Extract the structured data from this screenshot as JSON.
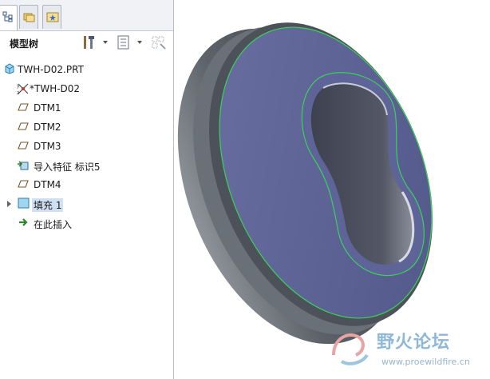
{
  "model_tree": {
    "title": "模型树",
    "tabs": [
      {
        "icon": "model-tree-icon",
        "active": true
      },
      {
        "icon": "folder-browser-icon",
        "active": false
      },
      {
        "icon": "favorites-icon",
        "active": false
      }
    ],
    "toolbar_icons": [
      "settings-icon",
      "show-icon",
      "filter-icon"
    ],
    "items": [
      {
        "label": "TWH-D02.PRT",
        "icon": "part-icon"
      },
      {
        "label": "TWH-D02",
        "icon": "coordinate-system-icon"
      },
      {
        "label": "DTM1",
        "icon": "datum-plane-icon"
      },
      {
        "label": "DTM2",
        "icon": "datum-plane-icon"
      },
      {
        "label": "DTM3",
        "icon": "datum-plane-icon"
      },
      {
        "label": "导入特征 标识5",
        "icon": "import-feature-icon"
      },
      {
        "label": "DTM4",
        "icon": "datum-plane-icon"
      },
      {
        "label": "填充 1",
        "icon": "fill-feature-icon",
        "selected": true
      },
      {
        "label": "在此插入",
        "icon": "insert-here-arrow-icon"
      }
    ]
  },
  "viewport": {
    "watermark_text": "野火论坛",
    "watermark_url": "www.proewildfire.cn",
    "colors": {
      "face": "#5d6294",
      "edge": "#39d25a",
      "rim": "#6f757c"
    }
  }
}
